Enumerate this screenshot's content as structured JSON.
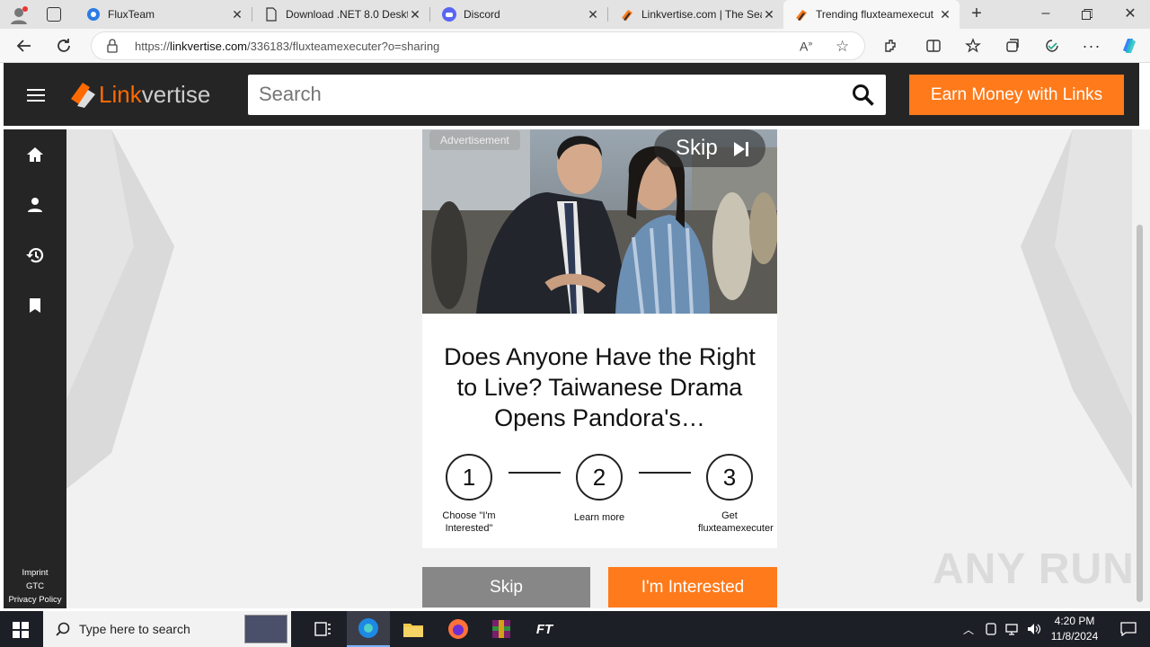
{
  "browser": {
    "tabs": [
      {
        "title": "FluxTeam",
        "icon": "edge-blue-icon"
      },
      {
        "title": "Download .NET 8.0 Deskt",
        "icon": "page-icon"
      },
      {
        "title": "Discord",
        "icon": "discord-icon"
      },
      {
        "title": "Linkvertise.com | The Sea",
        "icon": "linkvertise-icon"
      },
      {
        "title": "Trending fluxteamexecut",
        "icon": "linkvertise-icon",
        "active": true
      }
    ],
    "url_prefix": "https://",
    "url_domain": "linkvertise.com",
    "url_path": "/336183/fluxteamexecuter?o=sharing"
  },
  "site": {
    "logo_link": "Link",
    "logo_vertise": "vertise",
    "search_placeholder": "Search",
    "earn_button": "Earn Money with Links",
    "sidebar": [
      "home-icon",
      "user-icon",
      "history-icon",
      "bookmark-icon"
    ],
    "footer": [
      "Imprint",
      "GTC",
      "Privacy Policy"
    ]
  },
  "ad": {
    "label": "Advertisement",
    "skip": "Skip",
    "headline": "Does Anyone Have the Right to Live? Taiwanese Drama Opens Pandora's…"
  },
  "steps": [
    {
      "num": "1",
      "label": "Choose \"I'm Interested\""
    },
    {
      "num": "2",
      "label": "Learn more"
    },
    {
      "num": "3",
      "label": "Get fluxteamexecuter"
    }
  ],
  "buttons": {
    "skip": "Skip",
    "interested": "I'm Interested"
  },
  "watermark": "ANY RUN",
  "taskbar": {
    "search_placeholder": "Type here to search",
    "time": "4:20 PM",
    "date": "11/8/2024",
    "pinned_app_text": "FT"
  },
  "colors": {
    "accent": "#ff7a1a",
    "header": "#252525",
    "skip_button": "#878787"
  }
}
